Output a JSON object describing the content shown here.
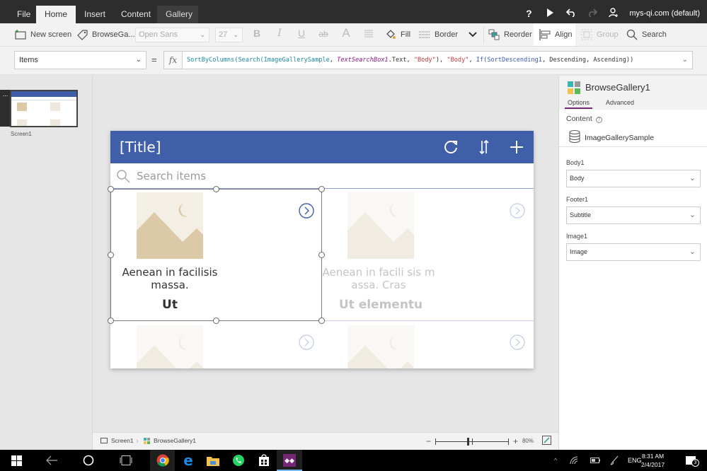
{
  "menubar": {
    "tabs": [
      {
        "label": "File",
        "active": false
      },
      {
        "label": "Home",
        "active": true
      },
      {
        "label": "Insert",
        "active": false
      },
      {
        "label": "Content",
        "active": false
      },
      {
        "label": "Gallery",
        "active": false
      }
    ],
    "account": "mys-qi.com (default)",
    "icons": [
      "help-icon",
      "play-icon",
      "undo-icon",
      "redo-icon",
      "share-user-icon"
    ]
  },
  "ribbon": {
    "new_screen": "New screen",
    "control_name": "BrowseGa...",
    "font": "Open Sans",
    "font_size": "27",
    "bold": "B",
    "italic": "I",
    "underline": "U",
    "strikethrough": "ab",
    "font_color": "A",
    "fill": "Fill",
    "border": "Border",
    "reorder": "Reorder",
    "align": "Align",
    "group": "Group",
    "search": "Search"
  },
  "formula_bar": {
    "property": "Items",
    "equals": "=",
    "fx": "fx",
    "formula_tokens": [
      {
        "t": "fn",
        "v": "SortByColumns("
      },
      {
        "t": "fn",
        "v": "Search("
      },
      {
        "t": "fn",
        "v": "ImageGallerySample"
      },
      {
        "t": "pl",
        "v": ", "
      },
      {
        "t": "ctl",
        "v": "TextSearchBox1"
      },
      {
        "t": "pl",
        "v": ".Text, "
      },
      {
        "t": "str",
        "v": "\"Body\""
      },
      {
        "t": "pl",
        "v": "), "
      },
      {
        "t": "str",
        "v": "\"Body\""
      },
      {
        "t": "pl",
        "v": ", "
      },
      {
        "t": "kw",
        "v": "If("
      },
      {
        "t": "kw",
        "v": "SortDescending1"
      },
      {
        "t": "pl",
        "v": ", Descending, Ascending))"
      }
    ]
  },
  "screens_panel": {
    "screens": [
      {
        "label": "Screen1"
      }
    ],
    "more": "..."
  },
  "app_preview": {
    "title": "[Title]",
    "header_icons": [
      "refresh-icon",
      "sort-icon",
      "add-icon"
    ],
    "search_placeholder": "Search items",
    "items": [
      {
        "body": "Aenean in facilisis massa.",
        "footer": "Ut",
        "selected": true
      },
      {
        "body": "Aenean in facili sis massa. Cras",
        "footer": "Ut elementu",
        "selected": false
      },
      {
        "body": "",
        "footer": "",
        "selected": false
      },
      {
        "body": "",
        "footer": "",
        "selected": false
      }
    ]
  },
  "properties_panel": {
    "control": "BrowseGallery1",
    "tabs": [
      {
        "label": "Options",
        "active": true
      },
      {
        "label": "Advanced",
        "active": false
      }
    ],
    "content_label": "Content",
    "data_source": "ImageGallerySample",
    "fields": [
      {
        "label": "Body1",
        "value": "Body"
      },
      {
        "label": "Footer1",
        "value": "Subtitle"
      },
      {
        "label": "Image1",
        "value": "Image"
      }
    ]
  },
  "status_bar": {
    "breadcrumb": [
      "Screen1",
      "BrowseGallery1"
    ],
    "zoom_minus": "−",
    "zoom_plus": "+",
    "zoom_level": "80%",
    "zoom_fraction": 0.44
  },
  "taskbar": {
    "apps": [
      "chrome-icon",
      "edge-icon",
      "file-explorer-icon",
      "whatsapp-icon",
      "store-icon",
      "powerapps-icon"
    ],
    "language": "ENG",
    "time": "8:31 AM",
    "date": "2/4/2017",
    "notifications": "3"
  },
  "colors": {
    "header_blue": "#3f5fa8",
    "accent_purple": "#742774",
    "menubar_dark": "#2d2d2d",
    "image_tan": "#dcc9a8"
  }
}
